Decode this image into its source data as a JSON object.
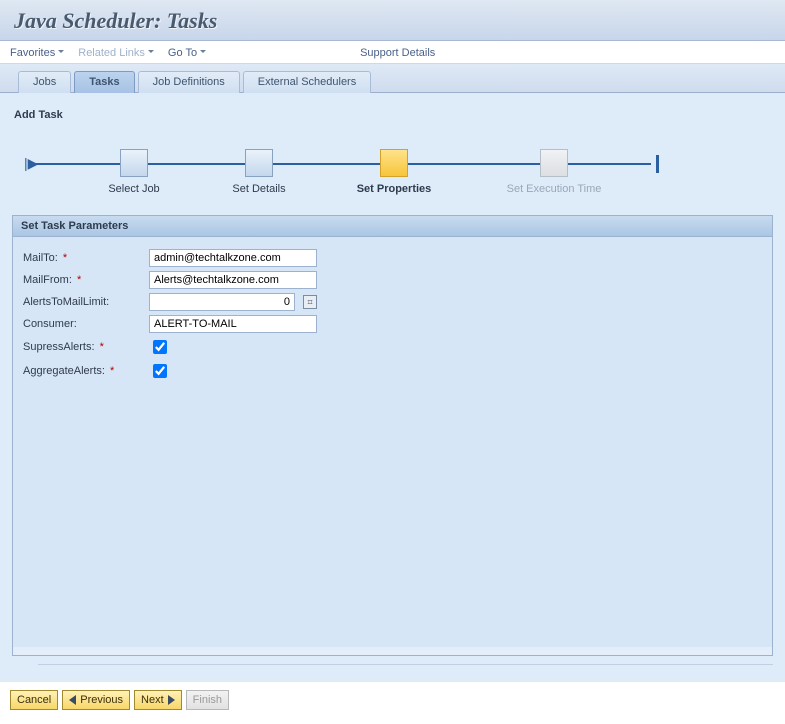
{
  "header": {
    "title": "Java Scheduler: Tasks"
  },
  "menubar": {
    "favorites": "Favorites",
    "related_links": "Related Links",
    "goto": "Go To",
    "support": "Support Details"
  },
  "tabs": [
    {
      "label": "Jobs",
      "active": false
    },
    {
      "label": "Tasks",
      "active": true
    },
    {
      "label": "Job Definitions",
      "active": false
    },
    {
      "label": "External Schedulers",
      "active": false
    }
  ],
  "section_title": "Add Task",
  "wizard_steps": [
    {
      "label": "Select Job",
      "state": "done"
    },
    {
      "label": "Set  Details",
      "state": "done"
    },
    {
      "label": "Set Properties",
      "state": "current"
    },
    {
      "label": "Set Execution Time",
      "state": "future"
    }
  ],
  "panel": {
    "title": "Set Task Parameters"
  },
  "form": {
    "mailto": {
      "label": "MailTo:",
      "required": true,
      "value": "admin@techtalkzone.com"
    },
    "mailfrom": {
      "label": "MailFrom:",
      "required": true,
      "value": "Alerts@techtalkzone.com"
    },
    "limit": {
      "label": "AlertsToMailLimit:",
      "required": false,
      "value": "0"
    },
    "consumer": {
      "label": "Consumer:",
      "required": false,
      "value": "ALERT-TO-MAIL"
    },
    "supress": {
      "label": "SupressAlerts:",
      "required": true,
      "checked": true
    },
    "aggregate": {
      "label": "AggregateAlerts:",
      "required": true,
      "checked": true
    }
  },
  "buttons": {
    "cancel": "Cancel",
    "previous": "Previous",
    "next": "Next",
    "finish": "Finish"
  }
}
